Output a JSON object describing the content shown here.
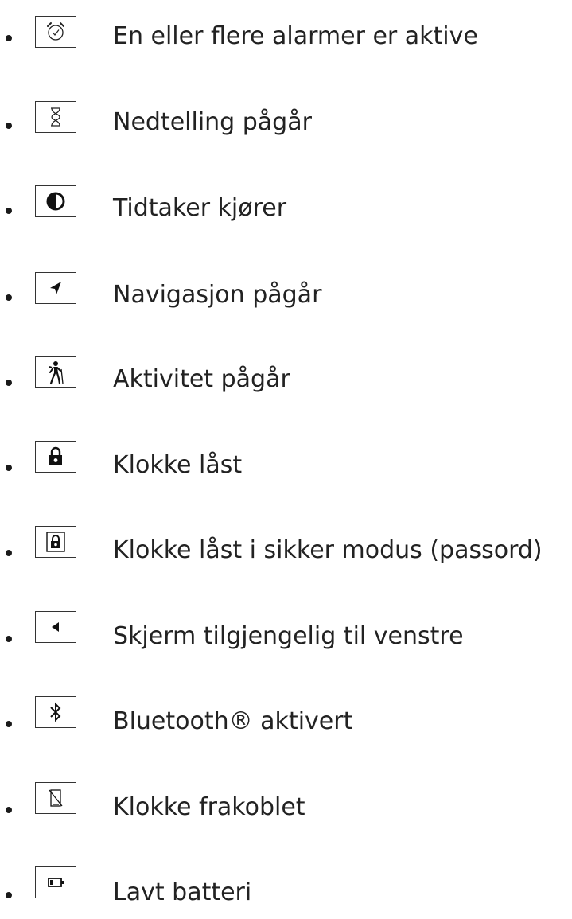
{
  "items": [
    {
      "icon": "alarm-clock-icon",
      "label": "En eller flere alarmer er aktive"
    },
    {
      "icon": "hourglass-icon",
      "label": "Nedtelling pågår"
    },
    {
      "icon": "half-circle-timer-icon",
      "label": "Tidtaker kjører"
    },
    {
      "icon": "navigation-arrow-icon",
      "label": "Navigasjon pågår"
    },
    {
      "icon": "hiker-icon",
      "label": "Aktivitet pågår"
    },
    {
      "icon": "padlock-icon",
      "label": "Klokke låst"
    },
    {
      "icon": "padlock-secure-icon",
      "label": "Klokke låst i sikker modus (passord)"
    },
    {
      "icon": "left-triangle-icon",
      "label": "Skjerm tilgjengelig til venstre"
    },
    {
      "icon": "bluetooth-icon",
      "label": "Bluetooth® aktivert"
    },
    {
      "icon": "phone-disconnected-icon",
      "label": "Klokke frakoblet"
    },
    {
      "icon": "low-battery-icon",
      "label": "Lavt batteri"
    }
  ]
}
